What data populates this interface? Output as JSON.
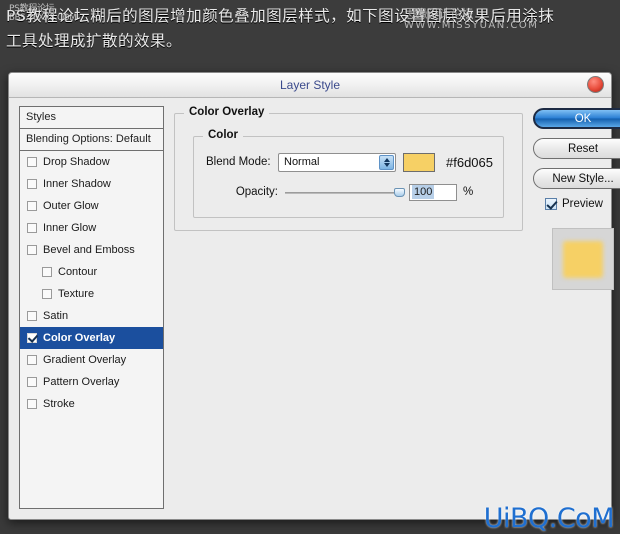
{
  "tutorial_text": {
    "line1": "PS教程论坛糊后的图层增加颜色叠加图层样式，如下图设置图层效果后用涂抹",
    "line2": "工具处理成扩散的效果。",
    "watermark_bbs_line1": "PS教程论坛",
    "watermark_bbs_line2": "BBS.16XX8.COM",
    "watermark_kiss_line1": "思缘设计论坛",
    "watermark_kiss_line2": "WWW.MISSYUAN.COM"
  },
  "dialog": {
    "title": "Layer Style",
    "close_icon": "close-icon"
  },
  "styles_panel": {
    "header": "Styles",
    "blending_options": "Blending Options: Default",
    "items": [
      {
        "label": "Drop Shadow",
        "checked": false,
        "indent": false,
        "selected": false
      },
      {
        "label": "Inner Shadow",
        "checked": false,
        "indent": false,
        "selected": false
      },
      {
        "label": "Outer Glow",
        "checked": false,
        "indent": false,
        "selected": false
      },
      {
        "label": "Inner Glow",
        "checked": false,
        "indent": false,
        "selected": false
      },
      {
        "label": "Bevel and Emboss",
        "checked": false,
        "indent": false,
        "selected": false
      },
      {
        "label": "Contour",
        "checked": false,
        "indent": true,
        "selected": false
      },
      {
        "label": "Texture",
        "checked": false,
        "indent": true,
        "selected": false
      },
      {
        "label": "Satin",
        "checked": false,
        "indent": false,
        "selected": false
      },
      {
        "label": "Color Overlay",
        "checked": true,
        "indent": false,
        "selected": true
      },
      {
        "label": "Gradient Overlay",
        "checked": false,
        "indent": false,
        "selected": false
      },
      {
        "label": "Pattern Overlay",
        "checked": false,
        "indent": false,
        "selected": false
      },
      {
        "label": "Stroke",
        "checked": false,
        "indent": false,
        "selected": false
      }
    ]
  },
  "color_overlay": {
    "section_title": "Color Overlay",
    "group_title": "Color",
    "blend_mode_label": "Blend Mode:",
    "blend_mode_value": "Normal",
    "blend_mode_options": [
      "Normal"
    ],
    "color_hex": "#f6d065",
    "color_hex_label": "#f6d065",
    "opacity_label": "Opacity:",
    "opacity_value": "100",
    "opacity_unit": "%"
  },
  "actions": {
    "ok": "OK",
    "reset": "Reset",
    "new_style": "New Style...",
    "preview_label": "Preview",
    "preview_checked": true
  },
  "colors": {
    "selection_blue": "#1b4f9e",
    "title_text": "#3b4a8c",
    "swatch": "#f6d065",
    "watermark_blue": "#1f6fd0"
  },
  "bottom_watermark": "UiBQ.CoM"
}
